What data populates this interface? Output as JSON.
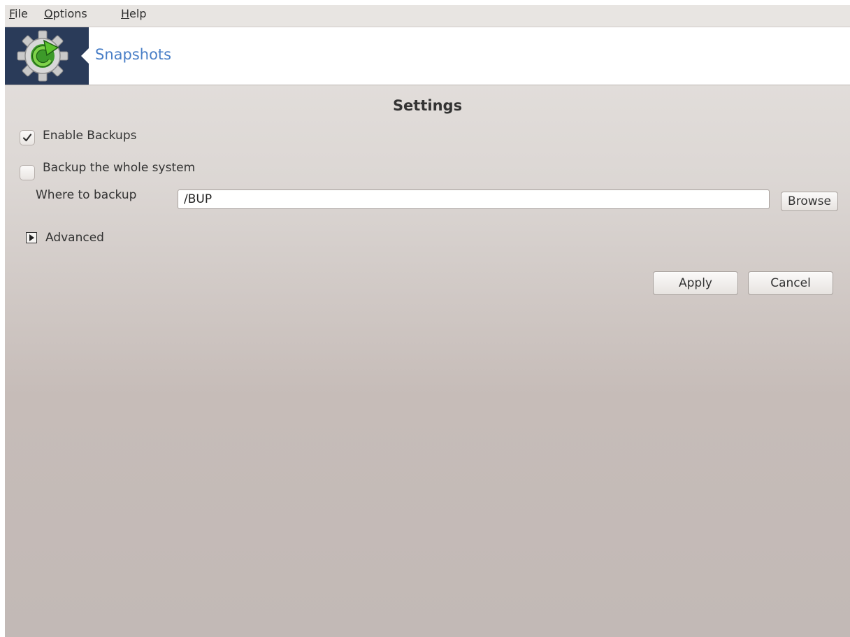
{
  "menubar": {
    "items": [
      {
        "label": "File",
        "mnemonic": "F",
        "rest": "ile"
      },
      {
        "label": "Options",
        "mnemonic": "O",
        "rest": "ptions"
      },
      {
        "label": "Help",
        "mnemonic": "H",
        "rest": "elp"
      }
    ]
  },
  "banner": {
    "title": "Snapshots",
    "icon": "gear-refresh-icon",
    "logo_bg": "#2a3b59",
    "title_color": "#4a7fc7"
  },
  "settings": {
    "title": "Settings",
    "enable_backups": {
      "label": "Enable Backups",
      "checked": true
    },
    "whole_system": {
      "label": "Backup the whole system",
      "checked": false
    },
    "where_label": "Where to backup",
    "where_value": "/BUP",
    "browse_label": "Browse",
    "advanced_label": "Advanced",
    "advanced_expanded": false
  },
  "actions": {
    "apply_label": "Apply",
    "cancel_label": "Cancel"
  }
}
